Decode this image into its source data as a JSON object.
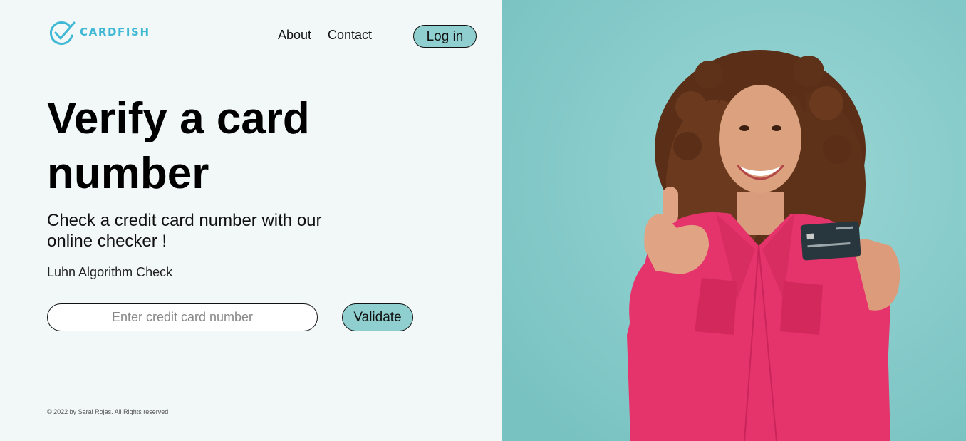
{
  "brand": {
    "name": "CARDFISH",
    "color": "#3fb8d6",
    "icon": "check-circle-icon"
  },
  "nav": {
    "about": "About",
    "contact": "Contact",
    "login": "Log in"
  },
  "hero": {
    "title": "Verify a card number",
    "subtitle": "Check a credit card number with our online checker !",
    "caption": "Luhn Algorithm Check"
  },
  "form": {
    "placeholder": "Enter credit card number",
    "value": "",
    "submit": "Validate"
  },
  "footer": {
    "text": "© 2022 by Sarai Rojas. All Rights reserved"
  },
  "colors": {
    "accent": "#8fcfcf",
    "left_bg": "#f1f8f7",
    "shirt": "#e5336b"
  }
}
